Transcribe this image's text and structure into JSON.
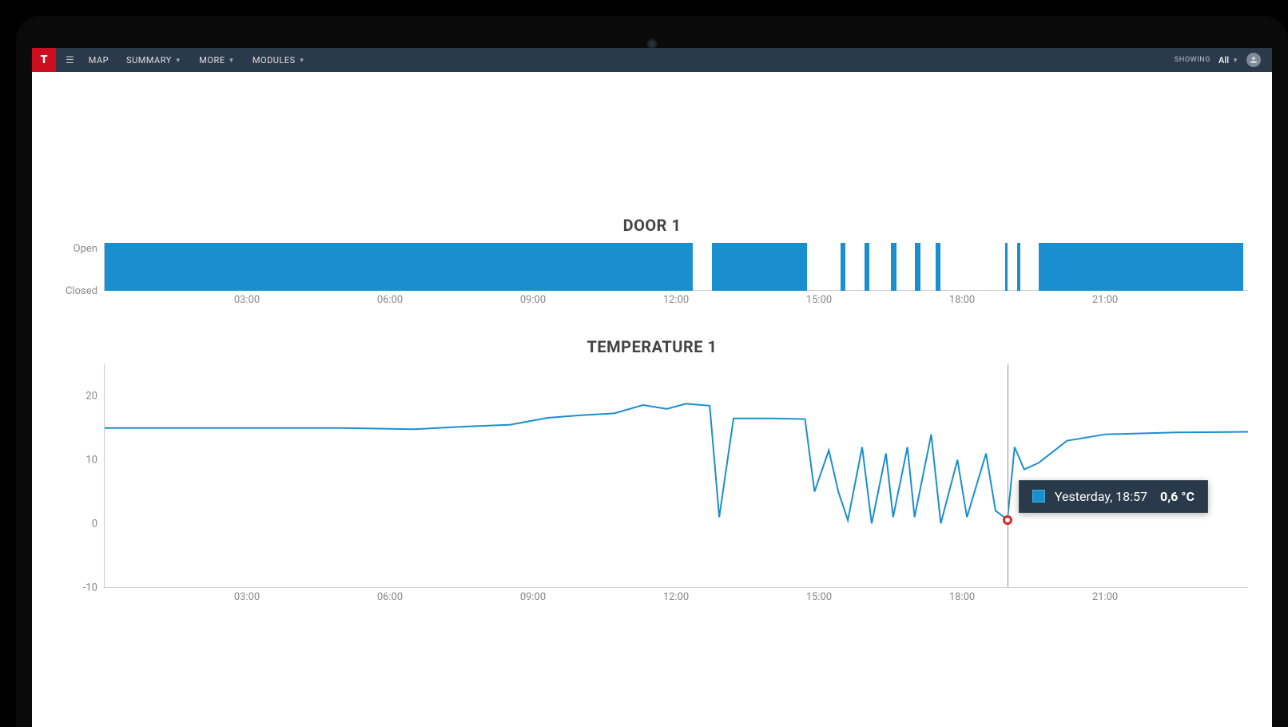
{
  "topbar": {
    "logo_letter": "T",
    "nav": {
      "map": "MAP",
      "summary": "SUMMARY",
      "more": "MORE",
      "modules": "MODULES"
    },
    "showing_label": "SHOWING",
    "filter_value": "All"
  },
  "door_chart": {
    "title": "DOOR 1",
    "y_open": "Open",
    "y_closed": "Closed"
  },
  "temp_chart": {
    "title": "TEMPERATURE 1"
  },
  "xticks": {
    "t03": "03:00",
    "t06": "06:00",
    "t09": "09:00",
    "t12": "12:00",
    "t15": "15:00",
    "t18": "18:00",
    "t21": "21:00"
  },
  "temp_yticks": {
    "p20": "20",
    "p10": "10",
    "p0": "0",
    "m10": "-10"
  },
  "tooltip": {
    "time_label": "Yesterday, 18:57",
    "value_label": "0,6 °C",
    "x_hour": 18.95,
    "y_value": 0.6
  },
  "chart_data": [
    {
      "type": "bar",
      "title": "DOOR 1",
      "ylabel": "",
      "categories": [
        "Closed",
        "Open"
      ],
      "x_range_hours": [
        0,
        24
      ],
      "open_segments_hours": [
        [
          0.0,
          12.35
        ],
        [
          12.75,
          14.75
        ],
        [
          15.45,
          15.55
        ],
        [
          15.95,
          16.05
        ],
        [
          16.5,
          16.62
        ],
        [
          17.0,
          17.12
        ],
        [
          17.45,
          17.55
        ],
        [
          18.9,
          18.95
        ],
        [
          19.15,
          19.22
        ],
        [
          19.6,
          23.9
        ]
      ]
    },
    {
      "type": "line",
      "title": "TEMPERATURE 1",
      "xlabel": "",
      "ylabel": "°C",
      "ylim": [
        -10,
        25
      ],
      "x_range_hours": [
        0,
        24
      ],
      "series": [
        {
          "name": "Temperature 1",
          "color": "#1a8fcf",
          "points": [
            [
              0.0,
              15.0
            ],
            [
              3.0,
              15.0
            ],
            [
              5.0,
              15.0
            ],
            [
              6.5,
              14.8
            ],
            [
              7.5,
              15.2
            ],
            [
              8.5,
              15.5
            ],
            [
              9.3,
              16.6
            ],
            [
              10.0,
              17.0
            ],
            [
              10.7,
              17.3
            ],
            [
              11.3,
              18.6
            ],
            [
              11.8,
              18.0
            ],
            [
              12.2,
              18.8
            ],
            [
              12.7,
              18.5
            ],
            [
              12.9,
              1.0
            ],
            [
              13.2,
              16.5
            ],
            [
              14.0,
              16.5
            ],
            [
              14.7,
              16.4
            ],
            [
              14.9,
              5.0
            ],
            [
              15.2,
              11.5
            ],
            [
              15.4,
              5.0
            ],
            [
              15.6,
              0.5
            ],
            [
              15.9,
              12.0
            ],
            [
              16.1,
              0.0
            ],
            [
              16.4,
              11.0
            ],
            [
              16.55,
              1.0
            ],
            [
              16.85,
              12.0
            ],
            [
              17.0,
              1.0
            ],
            [
              17.35,
              14.0
            ],
            [
              17.55,
              0.0
            ],
            [
              17.9,
              10.0
            ],
            [
              18.1,
              1.0
            ],
            [
              18.5,
              11.0
            ],
            [
              18.7,
              2.0
            ],
            [
              18.95,
              0.6
            ],
            [
              19.1,
              12.0
            ],
            [
              19.3,
              8.5
            ],
            [
              19.6,
              9.5
            ],
            [
              20.2,
              13.0
            ],
            [
              21.0,
              14.0
            ],
            [
              22.5,
              14.3
            ],
            [
              24.0,
              14.4
            ]
          ]
        }
      ],
      "highlight_point": {
        "x_hour": 18.95,
        "y": 0.6,
        "label": "Yesterday, 18:57",
        "value_text": "0,6 °C"
      }
    }
  ]
}
